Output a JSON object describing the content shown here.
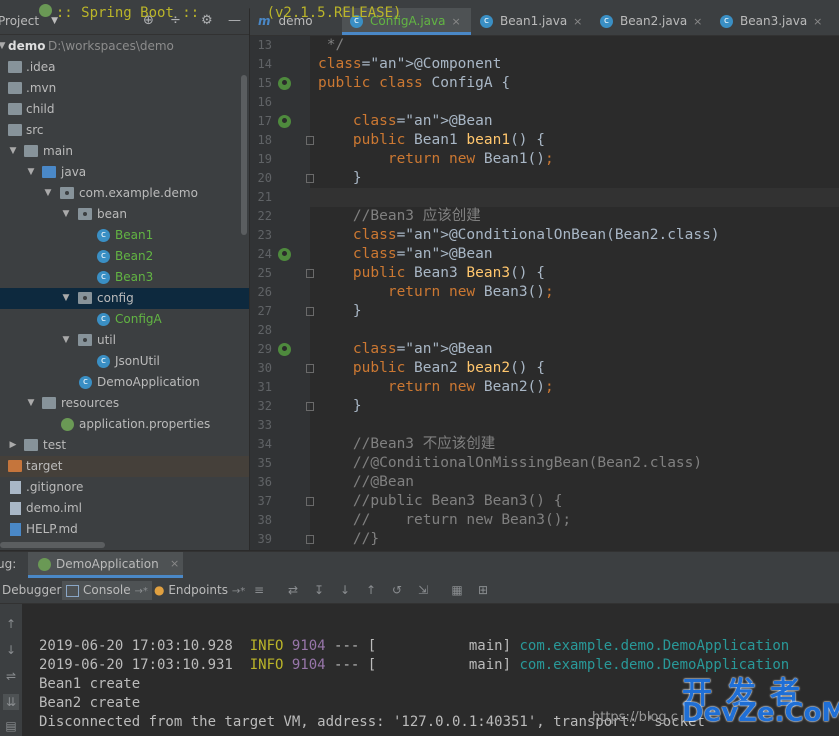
{
  "project_panel": {
    "title": "Project",
    "tree": [
      {
        "label": "demo",
        "path": "D:\\workspaces\\demo"
      },
      {
        "label": ".idea"
      },
      {
        "label": ".mvn"
      },
      {
        "label": "child"
      },
      {
        "label": "src"
      },
      {
        "label": "main"
      },
      {
        "label": "java"
      },
      {
        "label": "com.example.demo"
      },
      {
        "label": "bean"
      },
      {
        "label": "Bean1"
      },
      {
        "label": "Bean2"
      },
      {
        "label": "Bean3"
      },
      {
        "label": "config"
      },
      {
        "label": "ConfigA"
      },
      {
        "label": "util"
      },
      {
        "label": "JsonUtil"
      },
      {
        "label": "DemoApplication"
      },
      {
        "label": "resources"
      },
      {
        "label": "application.properties"
      },
      {
        "label": "test"
      },
      {
        "label": "target"
      },
      {
        "label": ".gitignore"
      },
      {
        "label": "demo.iml"
      },
      {
        "label": "HELP.md"
      }
    ]
  },
  "editor": {
    "tabs": [
      {
        "label": "demo",
        "icon": "maven-icon"
      },
      {
        "label": "ConfigA.java",
        "icon": "class-icon",
        "active": true
      },
      {
        "label": "Bean1.java",
        "icon": "class-icon"
      },
      {
        "label": "Bean2.java",
        "icon": "class-icon"
      },
      {
        "label": "Bean3.java",
        "icon": "class-icon"
      }
    ],
    "lines": [
      {
        "n": "13",
        "text": " */"
      },
      {
        "n": "14",
        "text": "@Component"
      },
      {
        "n": "15",
        "text": "public class ConfigA {"
      },
      {
        "n": "16",
        "text": ""
      },
      {
        "n": "17",
        "text": "    @Bean"
      },
      {
        "n": "18",
        "text": "    public Bean1 bean1() {"
      },
      {
        "n": "19",
        "text": "        return new Bean1();"
      },
      {
        "n": "20",
        "text": "    }"
      },
      {
        "n": "21",
        "text": ""
      },
      {
        "n": "22",
        "text": "    //Bean3 应该创建"
      },
      {
        "n": "23",
        "text": "    @ConditionalOnBean(Bean2.class)"
      },
      {
        "n": "24",
        "text": "    @Bean"
      },
      {
        "n": "25",
        "text": "    public Bean3 Bean3() {"
      },
      {
        "n": "26",
        "text": "        return new Bean3();"
      },
      {
        "n": "27",
        "text": "    }"
      },
      {
        "n": "28",
        "text": ""
      },
      {
        "n": "29",
        "text": "    @Bean"
      },
      {
        "n": "30",
        "text": "    public Bean2 bean2() {"
      },
      {
        "n": "31",
        "text": "        return new Bean2();"
      },
      {
        "n": "32",
        "text": "    }"
      },
      {
        "n": "33",
        "text": ""
      },
      {
        "n": "34",
        "text": "    //Bean3 不应该创建"
      },
      {
        "n": "35",
        "text": "    //@ConditionalOnMissingBean(Bean2.class)"
      },
      {
        "n": "36",
        "text": "    //@Bean"
      },
      {
        "n": "37",
        "text": "    //public Bean3 Bean3() {"
      },
      {
        "n": "38",
        "text": "    //    return new Bean3();"
      },
      {
        "n": "39",
        "text": "    //}"
      }
    ]
  },
  "debug": {
    "label": "ug:",
    "session": "DemoApplication",
    "toolbar": {
      "debugger": "Debugger",
      "console": "Console",
      "endpoints": "Endpoints"
    }
  },
  "console": {
    "lines": [
      {
        "text": "  :: Spring Boot ::        (v2.1.5.RELEASE)"
      },
      {
        "text": ""
      },
      {
        "time": "2019-06-20 17:03:10.928",
        "level": "INFO",
        "pid": "9104",
        "mid": " --- [           main] ",
        "logger": "com.example.demo.DemoApplication"
      },
      {
        "time": "2019-06-20 17:03:10.931",
        "level": "INFO",
        "pid": "9104",
        "mid": " --- [           main] ",
        "logger": "com.example.demo.DemoApplication"
      },
      {
        "text": "Bean1 create"
      },
      {
        "text": "Bean2 create"
      },
      {
        "text": "Disconnected from the target VM, address: '127.0.0.1:40351', transport: 'socket'"
      }
    ]
  },
  "watermark": {
    "cn": "开发者",
    "en": "DevZe.CoM",
    "url": "https://blog.c"
  },
  "colors": {
    "keyword": "#cc7832",
    "annotation": "#bbb529",
    "method": "#ffc66d",
    "comment": "#808080",
    "text": "#a9b7c6",
    "selection": "#0d293e"
  }
}
